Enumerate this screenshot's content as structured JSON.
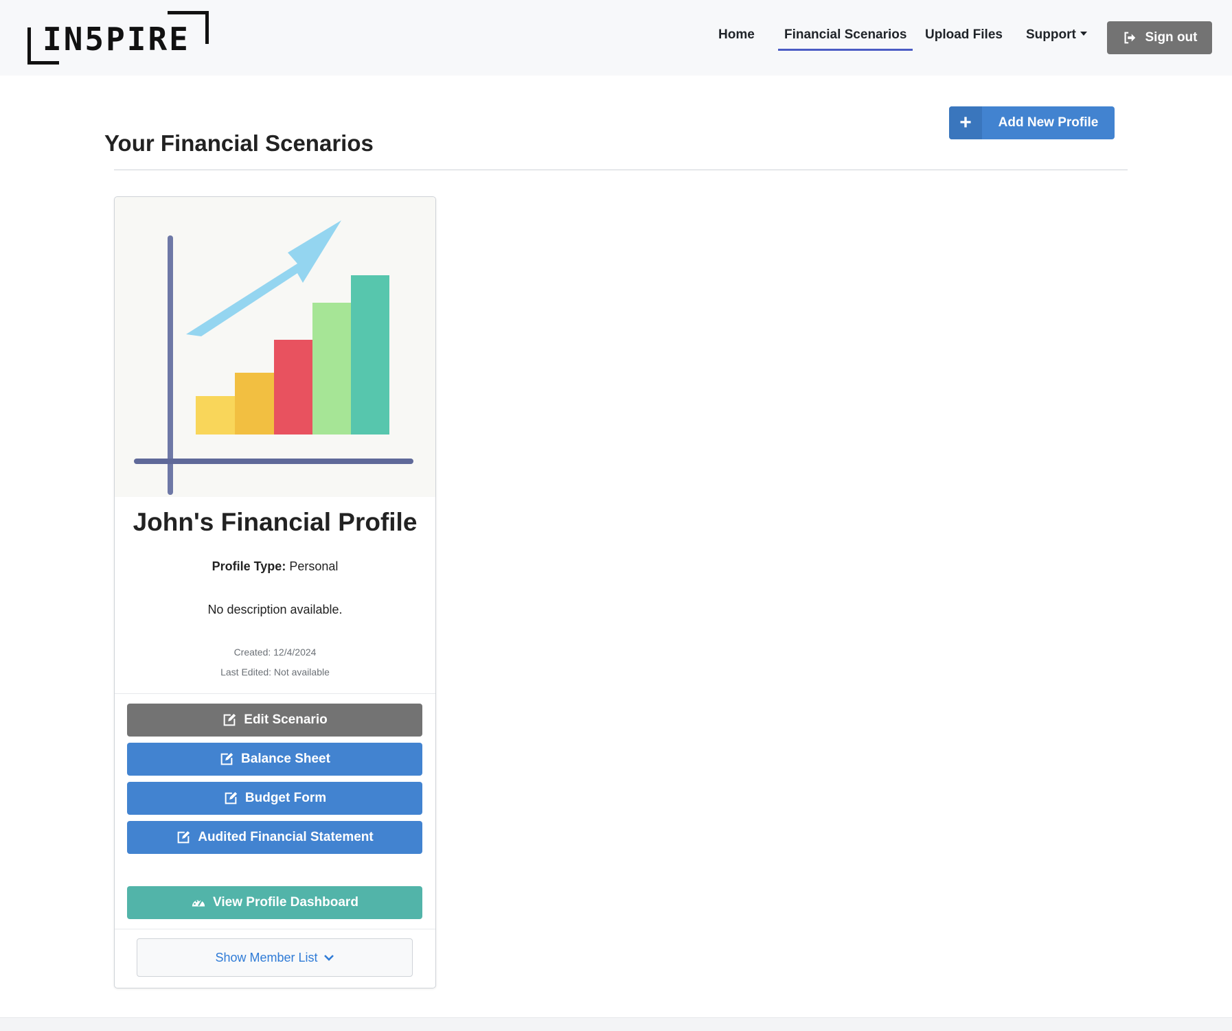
{
  "brand": {
    "logo_text": "IN5PIRE"
  },
  "nav": {
    "home": "Home",
    "scenarios": "Financial Scenarios",
    "upload": "Upload Files",
    "support": "Support",
    "signout": "Sign out"
  },
  "page": {
    "title": "Your Financial Scenarios",
    "add_button": "Add New Profile"
  },
  "card": {
    "title": "John's Financial Profile",
    "profile_type_label": "Profile Type:",
    "profile_type_value": "Personal",
    "description": "No description available.",
    "created": "Created: 12/4/2024",
    "last_edited": "Last Edited: Not available",
    "buttons": {
      "edit": "Edit Scenario",
      "balance": "Balance Sheet",
      "budget": "Budget Form",
      "audited": "Audited Financial Statement",
      "dashboard": "View Profile Dashboard"
    },
    "member_toggle": "Show Member List"
  },
  "colors": {
    "primary_blue": "#4283d0",
    "gray_button": "#737373",
    "teal_button": "#52b4a9",
    "active_underline": "#4a5bc4",
    "link_blue": "#2f7bd6"
  },
  "icons": {
    "signout": "sign-out-icon",
    "add": "plus-icon",
    "edit": "edit-icon",
    "dashboard": "dashboard-gauge-icon",
    "chevron": "chevron-down-icon"
  }
}
